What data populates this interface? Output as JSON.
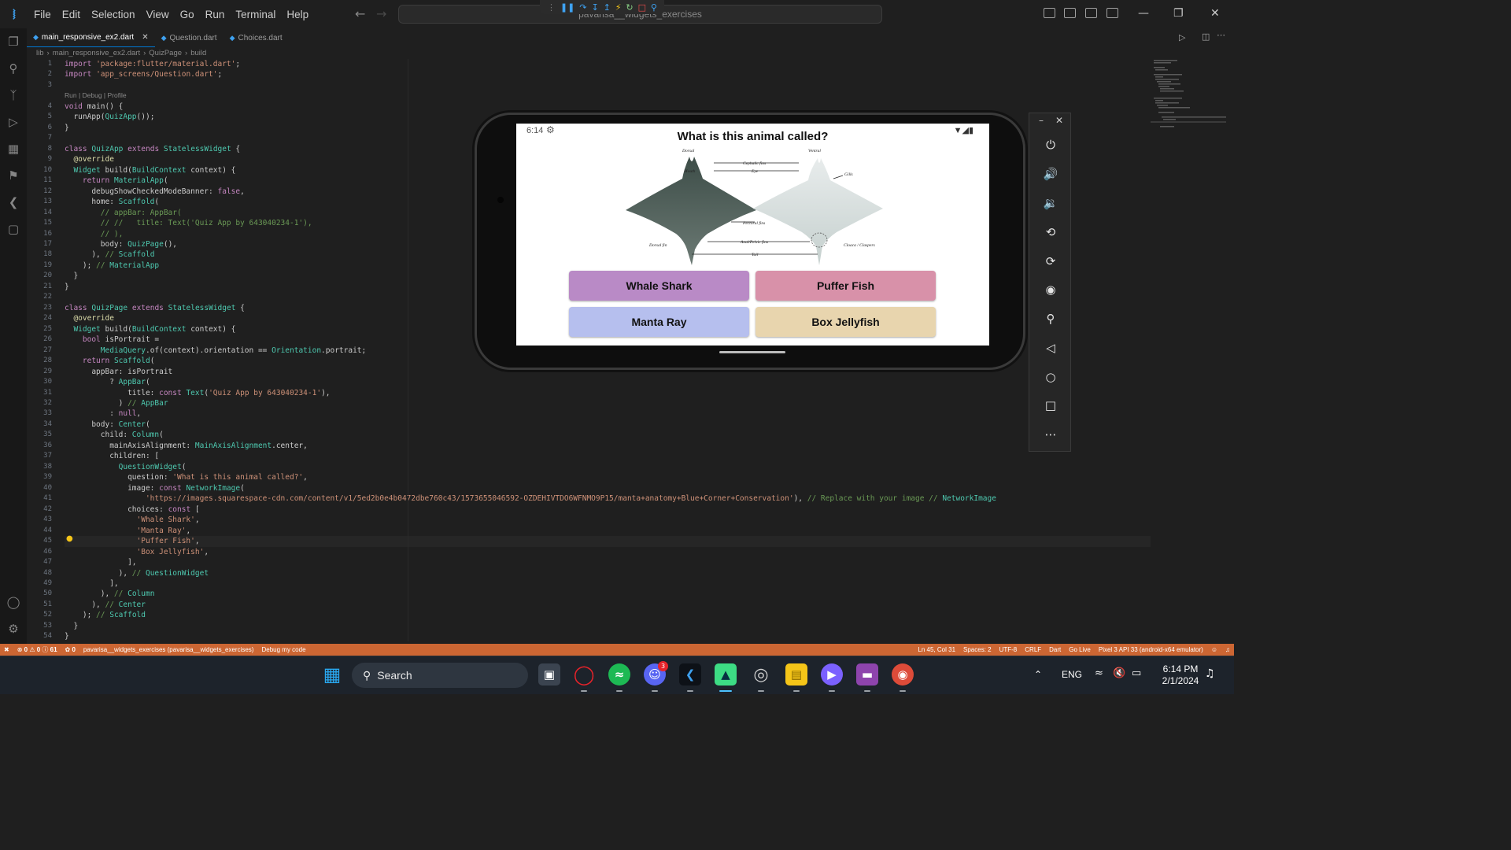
{
  "menu": [
    "File",
    "Edit",
    "Selection",
    "View",
    "Go",
    "Run",
    "Terminal",
    "Help"
  ],
  "search_placeholder": "pavarisa__widgets_exercises",
  "tabs": [
    {
      "label": "main_responsive_ex2.dart",
      "active": true
    },
    {
      "label": "Question.dart",
      "active": false
    },
    {
      "label": "Choices.dart",
      "active": false
    }
  ],
  "breadcrumb": [
    "lib",
    "main_responsive_ex2.dart",
    "QuizPage",
    "build"
  ],
  "code": {
    "codelens": "Run | Debug | Profile",
    "lines": [
      "import 'package:flutter/material.dart';",
      "import 'app_screens/Question.dart';",
      "",
      "void main() {",
      "  runApp(QuizApp());",
      "}",
      "",
      "class QuizApp extends StatelessWidget {",
      "  @override",
      "  Widget build(BuildContext context) {",
      "    return MaterialApp(",
      "      debugShowCheckedModeBanner: false,",
      "      home: Scaffold(",
      "        // appBar: AppBar(",
      "        // //   title: Text('Quiz App by 643040234-1'),",
      "        // ),",
      "        body: QuizPage(),",
      "      ), // Scaffold",
      "    ); // MaterialApp",
      "  }",
      "}",
      "",
      "class QuizPage extends StatelessWidget {",
      "  @override",
      "  Widget build(BuildContext context) {",
      "    bool isPortrait =",
      "        MediaQuery.of(context).orientation == Orientation.portrait;",
      "    return Scaffold(",
      "      appBar: isPortrait",
      "          ? AppBar(",
      "              title: const Text('Quiz App by 643040234-1'),",
      "            ) // AppBar",
      "          : null,",
      "      body: Center(",
      "        child: Column(",
      "          mainAxisAlignment: MainAxisAlignment.center,",
      "          children: [",
      "            QuestionWidget(",
      "              question: 'What is this animal called?',",
      "              image: const NetworkImage(",
      "                  'https://images.squarespace-cdn.com/content/v1/5ed2b0e4b0472dbe760c43/1573655046592-OZDEHIVTDO6WFNMO9P15/manta+anatomy+Blue+Corner+Conservation'), // Replace with your image // NetworkImage",
      "              choices: const [",
      "                'Whale Shark',",
      "                'Manta Ray',",
      "                'Puffer Fish',",
      "                'Box Jellyfish',",
      "              ],",
      "            ), // QuestionWidget",
      "          ],",
      "        ), // Column",
      "      ), // Center",
      "    ); // Scaffold",
      "  }",
      "}"
    ]
  },
  "phone": {
    "time": "6:14",
    "question": "What is this animal called?",
    "image_labels": {
      "dorsal": "Dorsal",
      "ventral": "Ventral",
      "cephalic": "Cephalic fins",
      "eye": "Eye",
      "mouth": "Mouth",
      "gills": "Gills",
      "pectoral": "Pectoral fins",
      "dorsal_fin": "Dorsal fin",
      "anal": "Anal/Pelvic fins",
      "claspers": "Cloaca / Claspers",
      "tail": "Tail"
    },
    "choices": [
      {
        "label": "Whale Shark",
        "color": "#b98ac6"
      },
      {
        "label": "Puffer Fish",
        "color": "#d891a9"
      },
      {
        "label": "Manta Ray",
        "color": "#b6bfee"
      },
      {
        "label": "Box Jellyfish",
        "color": "#e8d5ae"
      }
    ]
  },
  "statusbar": {
    "errors": "0",
    "warnings": "0",
    "infos": "61",
    "ports": "0",
    "project": "pavarisa__widgets_exercises (pavarisa__widgets_exercises)",
    "debug": "Debug my code",
    "position": "Ln 45, Col 31",
    "spaces": "Spaces: 2",
    "encoding": "UTF-8",
    "eol": "CRLF",
    "language": "Dart",
    "golive": "Go Live",
    "device": "Pixel 3 API 33 (android-x64 emulator)"
  },
  "taskbar": {
    "search": "Search",
    "lang": "ENG",
    "time": "6:14 PM",
    "date": "2/1/2024",
    "discord_badge": "3"
  },
  "colors": {
    "accent": "#0078d4",
    "statusbar": "#cc6633",
    "keyword": "#c586c0",
    "type": "#4ec9b0",
    "string": "#ce9178"
  }
}
